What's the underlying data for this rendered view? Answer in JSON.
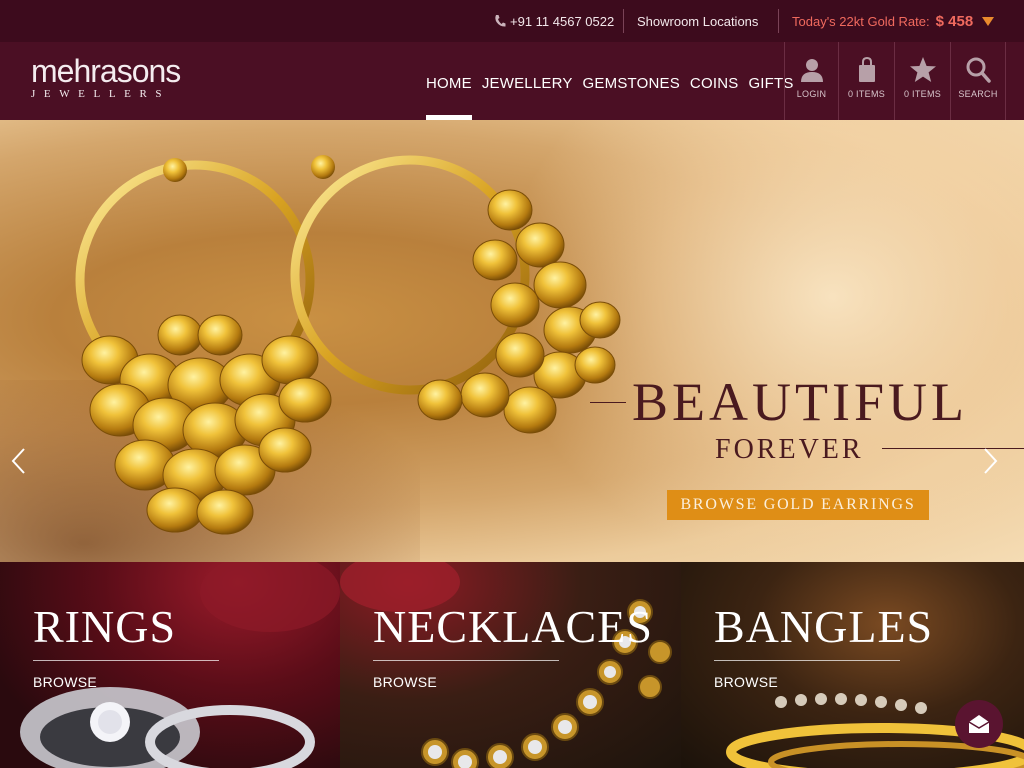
{
  "topbar": {
    "phone": "+91 11 4567 0522",
    "showroom": "Showroom Locations",
    "gold_label": "Today's 22kt Gold Rate:",
    "gold_value": "$ 458"
  },
  "logo": {
    "word": "mehrasons",
    "sub": "JEWELLERS"
  },
  "nav": {
    "items": [
      {
        "label": "HOME"
      },
      {
        "label": "JEWELLERY"
      },
      {
        "label": "GEMSTONES"
      },
      {
        "label": "COINS"
      },
      {
        "label": "GIFTS"
      }
    ]
  },
  "header_icons": {
    "login": "LOGIN",
    "cart": "0 ITEMS",
    "wishlist": "0 ITEMS",
    "search": "SEARCH"
  },
  "hero": {
    "headline": "BEAUTIFUL",
    "subline": "FOREVER",
    "cta": "BROWSE GOLD EARRINGS"
  },
  "categories": [
    {
      "title": "RINGS",
      "browse": "BROWSE"
    },
    {
      "title": "NECKLACES",
      "browse": "BROWSE"
    },
    {
      "title": "BANGLES",
      "browse": "BROWSE"
    }
  ],
  "colors": {
    "topbar_bg": "#3d0b1d",
    "header_bg": "#4b0f24",
    "gold_rate": "#f06a5e",
    "cta_bg": "#df8e16"
  },
  "icons": [
    "phone-icon",
    "chevron-down-icon",
    "user-icon",
    "shopping-bag-icon",
    "star-icon",
    "search-icon",
    "chevron-left-icon",
    "chevron-right-icon",
    "arrow-down-circle-icon",
    "chat-icon"
  ]
}
